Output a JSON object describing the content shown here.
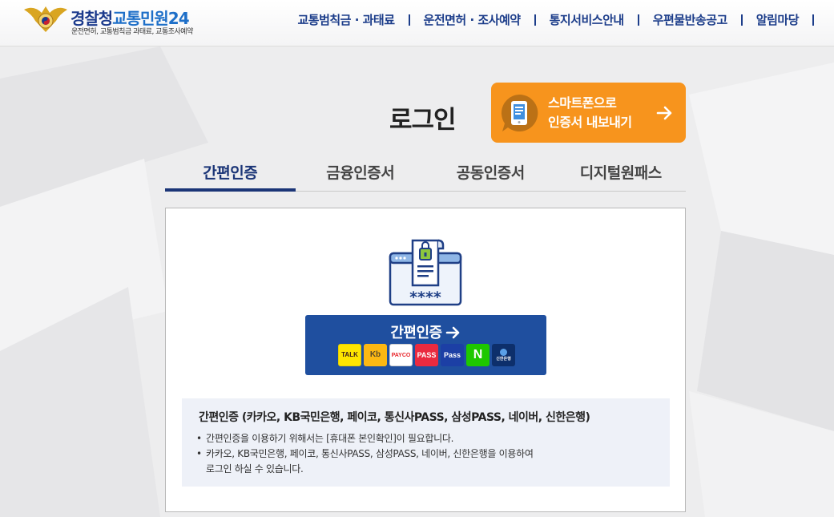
{
  "header": {
    "logo_title_a": "경찰청",
    "logo_title_b": "교통민원24",
    "logo_subtitle": "운전면허, 교통범칙금 과태료, 교통조사예약",
    "nav": [
      {
        "label": "교통범칙금 · 과태료"
      },
      {
        "label": "운전면허 · 조사예약"
      },
      {
        "label": "통지서비스안내"
      },
      {
        "label": "우편물반송공고"
      },
      {
        "label": "알림마당"
      }
    ]
  },
  "login": {
    "title": "로그인",
    "export_line1": "스마트폰으로",
    "export_line2": "인증서 내보내기"
  },
  "tabs": [
    {
      "label": "간편인증",
      "active": true
    },
    {
      "label": "금융인증서",
      "active": false
    },
    {
      "label": "공동인증서",
      "active": false
    },
    {
      "label": "디지털원패스",
      "active": false
    }
  ],
  "easy_auth": {
    "button_label": "간편인증",
    "cert_masked": "****",
    "providers": [
      {
        "name": "kakao-talk",
        "text": "TALK",
        "bg": "#fee500",
        "fg": "#3c1e1e"
      },
      {
        "name": "kb-bank",
        "text": "Kb",
        "bg": "#fcb813",
        "fg": "#5a4a2a"
      },
      {
        "name": "payco",
        "text": "PAYCO",
        "bg": "#ffffff",
        "fg": "#e8262c"
      },
      {
        "name": "pass",
        "text": "PASS",
        "bg": "#ea2a3f",
        "fg": "#ffffff"
      },
      {
        "name": "samsung-pass",
        "text": "Pass",
        "bg": "#1c3fa5",
        "fg": "#ffffff"
      },
      {
        "name": "naver",
        "text": "N",
        "bg": "#1ec800",
        "fg": "#ffffff"
      },
      {
        "name": "shinhan-bank",
        "text": "신한은행",
        "bg": "#0d2f6b",
        "fg": "#ffffff"
      }
    ]
  },
  "info": {
    "title": "간편인증 (카카오, KB국민은행, 페이코, 통신사PASS, 삼성PASS, 네이버, 신한은행)",
    "items": [
      {
        "line1": "간편인증을 이용하기 위해서는 [휴대폰 본인확인]이 필요합니다."
      },
      {
        "line1": "카카오, KB국민은행, 페이코, 통신사PASS, 삼성PASS, 네이버, 신한은행을 이용하여",
        "line2": "로그인 하실 수 있습니다."
      }
    ]
  },
  "colors": {
    "navy": "#1b3577",
    "orange": "#f7941d",
    "button_blue": "#1f4f9f"
  }
}
